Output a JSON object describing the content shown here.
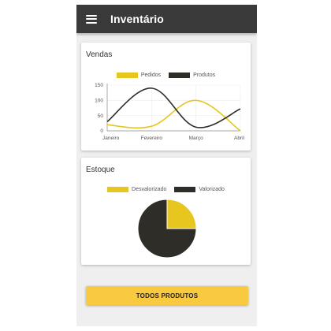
{
  "app": {
    "title": "Inventário"
  },
  "colors": {
    "primary": "#3a3a3a",
    "accent": "#e8c620",
    "dark_series": "#2f2d28",
    "button": "#f9c940"
  },
  "sales_card": {
    "title": "Vendas"
  },
  "stock_card": {
    "title": "Estoque"
  },
  "button": {
    "label": "TODOS PRODUTOS"
  },
  "chart_data": [
    {
      "type": "line",
      "title": "Vendas",
      "categories": [
        "Janeiro",
        "Fevereiro",
        "Março",
        "Abril"
      ],
      "ylim": [
        0,
        150
      ],
      "yticks": [
        0,
        50,
        100,
        150
      ],
      "series": [
        {
          "name": "Pedidos",
          "color": "#e8c620",
          "values": [
            20,
            15,
            100,
            0
          ]
        },
        {
          "name": "Produtos",
          "color": "#2f2d28",
          "values": [
            30,
            140,
            12,
            72
          ]
        }
      ],
      "grid": true,
      "legend": "top"
    },
    {
      "type": "pie",
      "title": "Estoque",
      "labels": [
        "Desvalorizado",
        "Valorizado"
      ],
      "values": [
        25,
        75
      ],
      "colors": [
        "#e8c620",
        "#2f2d28"
      ],
      "legend": "top"
    }
  ]
}
